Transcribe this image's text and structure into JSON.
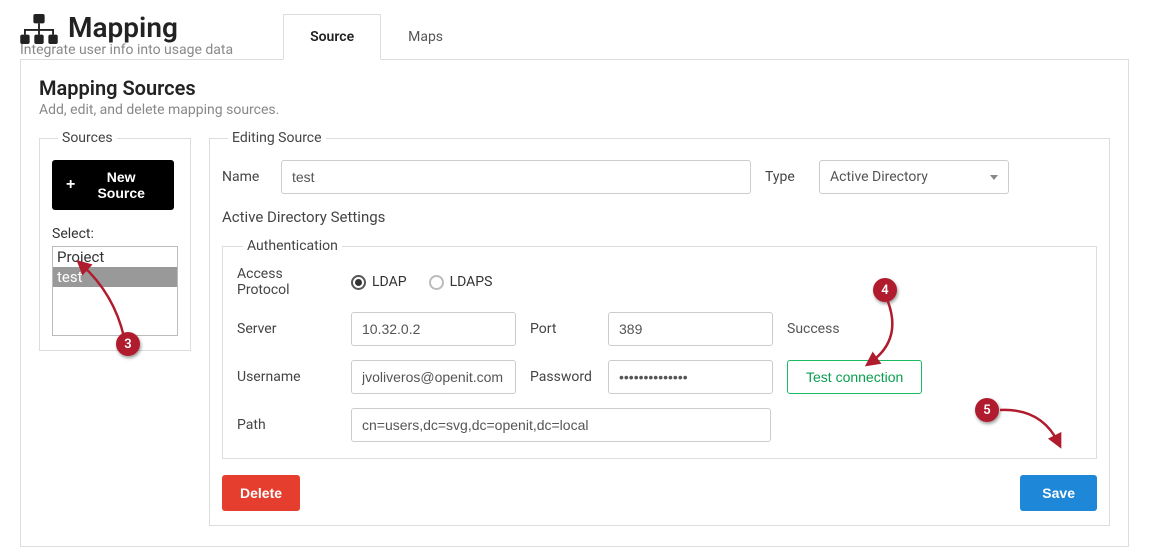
{
  "header": {
    "title": "Mapping",
    "subtitle": "Integrate user info into usage data"
  },
  "tabs": [
    {
      "label": "Source",
      "active": true
    },
    {
      "label": "Maps",
      "active": false
    }
  ],
  "panel": {
    "title": "Mapping Sources",
    "subtitle": "Add, edit, and delete mapping sources."
  },
  "sources": {
    "legend": "Sources",
    "new_button": "New Source",
    "select_label": "Select:",
    "options": [
      {
        "label": "Project",
        "selected": false
      },
      {
        "label": "test",
        "selected": true
      }
    ]
  },
  "editing": {
    "legend": "Editing Source",
    "name_label": "Name",
    "name_value": "test",
    "type_label": "Type",
    "type_value": "Active Directory",
    "settings_title": "Active Directory Settings",
    "auth": {
      "legend": "Authentication",
      "access_label": "Access Protocol",
      "protocols": [
        {
          "label": "LDAP",
          "selected": true
        },
        {
          "label": "LDAPS",
          "selected": false
        }
      ],
      "server_label": "Server",
      "server_value": "10.32.0.2",
      "port_label": "Port",
      "port_value": "389",
      "status": "Success",
      "username_label": "Username",
      "username_value": "jvoliveros@openit.com",
      "password_label": "Password",
      "password_value": "••••••••••••••",
      "test_button": "Test connection",
      "path_label": "Path",
      "path_value": "cn=users,dc=svg,dc=openit,dc=local"
    },
    "delete_button": "Delete",
    "save_button": "Save"
  },
  "annotations": {
    "b3": "3",
    "b4": "4",
    "b5": "5"
  }
}
